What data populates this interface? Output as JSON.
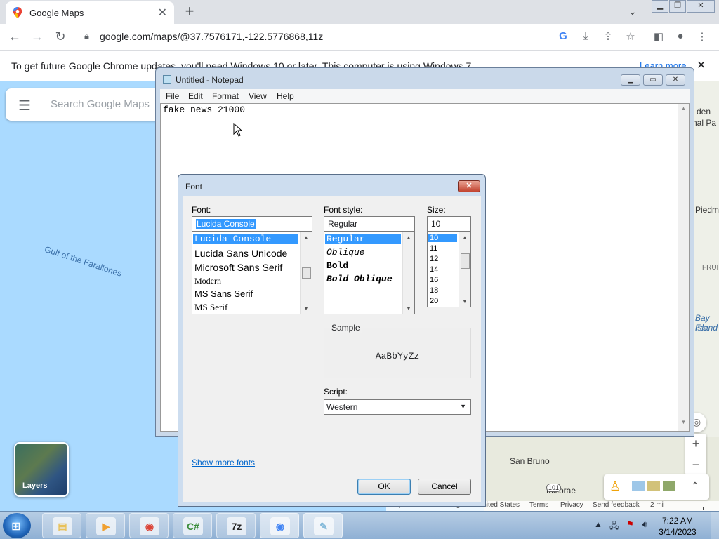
{
  "browser": {
    "tab_title": "Google Maps",
    "tab_close": "✕",
    "new_tab": "+",
    "tab_search": "⌄",
    "url": "google.com/maps/@37.7576171,-122.5776868,11z",
    "infobar_message": "To get future Google Chrome updates, you'll need Windows 10 or later. This computer is using Windows 7.",
    "infobar_link": "Learn more",
    "infobar_close": "✕"
  },
  "map": {
    "search_placeholder": "Search Google Maps",
    "gulf_label": "Gulf of the Farallones",
    "fragments": {
      "golden_gate": "den",
      "golden_gate2": "nal Pa",
      "piedm": "Piedm",
      "fruit": "FRUIT",
      "bay_farm": "Bay Far",
      "island": "Island",
      "san_bruno": "San Bruno",
      "millbrae": "Millbrae",
      "route": "101"
    },
    "layers_label": "Layers",
    "zoom_in": "+",
    "zoom_out": "−",
    "attribution": {
      "data": "Map data ©2023 Google",
      "united_states": "United States",
      "terms": "Terms",
      "privacy": "Privacy",
      "feedback": "Send feedback",
      "scale": "2 mi"
    }
  },
  "notepad": {
    "title": "Untitled - Notepad",
    "menu": [
      "File",
      "Edit",
      "Format",
      "View",
      "Help"
    ],
    "content": "fake news 21000"
  },
  "font_dialog": {
    "title": "Font",
    "close": "✕",
    "font_label": "Font:",
    "font_value": "Lucida Console",
    "fonts": [
      "Lucida Console",
      "Lucida Sans Unicode",
      "Microsoft Sans Serif",
      "Modern",
      "MS Sans Serif",
      "MS Serif"
    ],
    "style_label": "Font style:",
    "style_value": "Regular",
    "styles": [
      "Regular",
      "Oblique",
      "Bold",
      "Bold Oblique"
    ],
    "size_label": "Size:",
    "size_value": "10",
    "sizes": [
      "10",
      "11",
      "12",
      "14",
      "16",
      "18",
      "20"
    ],
    "sample_label": "Sample",
    "sample_text": "AaBbYyZz",
    "script_label": "Script:",
    "script_value": "Western",
    "show_more_fonts": "Show more fonts",
    "ok": "OK",
    "cancel": "Cancel"
  },
  "taskbar": {
    "clock_time": "7:22 AM",
    "clock_date": "3/14/2023",
    "apps": [
      {
        "name": "file-explorer",
        "glyph": "▤",
        "color": "#e8c15a"
      },
      {
        "name": "media-player",
        "glyph": "▶",
        "color": "#f0a030"
      },
      {
        "name": "chrome",
        "glyph": "◉",
        "color": "#db4437"
      },
      {
        "name": "csharp-app",
        "glyph": "C#",
        "color": "#3c8d3c"
      },
      {
        "name": "7zip",
        "glyph": "7z",
        "color": "#222222"
      },
      {
        "name": "chrome-alt",
        "glyph": "◉",
        "color": "#4285f4"
      },
      {
        "name": "notepad",
        "glyph": "✎",
        "color": "#7fb7d8"
      }
    ]
  },
  "colors": {
    "accent_blue": "#1a73e8",
    "selection_blue": "#3399ff",
    "map_water": "#aadaff"
  }
}
